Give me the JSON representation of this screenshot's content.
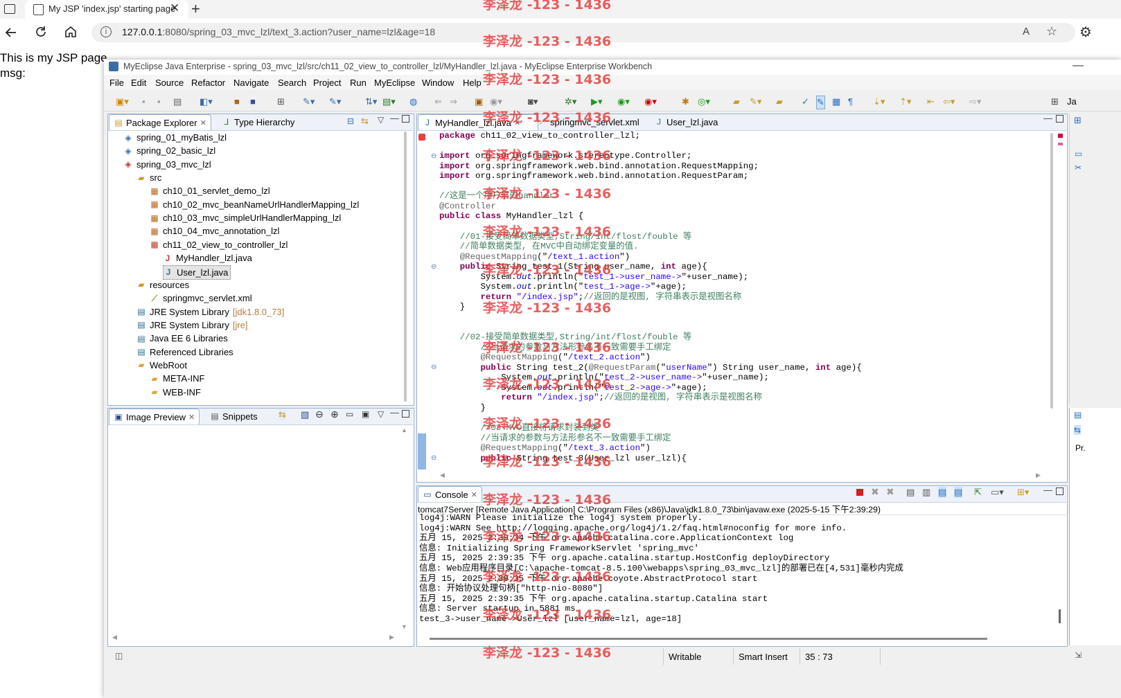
{
  "browser": {
    "tab_title": "My JSP 'index.jsp' starting page",
    "url_host": "127.0.0.1",
    "url_rest": ":8080/spring_03_mvc_lzl/text_3.action?user_name=lzl&age=18"
  },
  "page": {
    "line1": "This is my JSP page.",
    "line2": "msg:"
  },
  "watermark": "李泽龙 -123 - 1436",
  "eclipse": {
    "title": "MyEclipse Java Enterprise - spring_03_mvc_lzl/src/ch11_02_view_to_controller_lzl/MyHandler_lzl.java - MyEclipse Enterprise Workbench",
    "menu": [
      "File",
      "Edit",
      "Source",
      "Refactor",
      "Navigate",
      "Search",
      "Project",
      "Run",
      "MyEclipse",
      "Window",
      "Help"
    ],
    "perspective_label": "Ja"
  },
  "package_explorer": {
    "tabs": [
      "Package Explorer",
      "Type Hierarchy"
    ],
    "items": [
      {
        "label": "spring_01_myBatis_lzl",
        "icon": "project-icon",
        "depth": 0
      },
      {
        "label": "spring_02_basic_lzl",
        "icon": "project-icon",
        "depth": 0
      },
      {
        "label": "spring_03_mvc_lzl",
        "icon": "project-error-icon",
        "depth": 0
      },
      {
        "label": "src",
        "icon": "source-folder-icon",
        "depth": 1
      },
      {
        "label": "ch10_01_servlet_demo_lzl",
        "icon": "package-icon",
        "depth": 2
      },
      {
        "label": "ch10_02_mvc_beanNameUrlHandlerMapping_lzl",
        "icon": "package-icon",
        "depth": 2
      },
      {
        "label": "ch10_03_mvc_simpleUrlHandlerMapping_lzl",
        "icon": "package-icon",
        "depth": 2
      },
      {
        "label": "ch10_04_mvc_annotation_lzl",
        "icon": "package-icon",
        "depth": 2
      },
      {
        "label": "ch11_02_view_to_controller_lzl",
        "icon": "package-error-icon",
        "depth": 2
      },
      {
        "label": "MyHandler_lzl.java",
        "icon": "java-file-error-icon",
        "depth": 3
      },
      {
        "label": "User_lzl.java",
        "icon": "java-file-icon",
        "depth": 3
      },
      {
        "label": "resources",
        "icon": "source-folder-icon",
        "depth": 1
      },
      {
        "label": "springmvc_servlet.xml",
        "icon": "xml-file-icon",
        "depth": 2
      },
      {
        "label": "JRE System Library",
        "suffix": "[jdk1.8.0_73]",
        "icon": "library-icon",
        "depth": 1
      },
      {
        "label": "JRE System Library",
        "suffix": "[jre]",
        "icon": "library-icon",
        "depth": 1
      },
      {
        "label": "Java EE 6 Libraries",
        "icon": "library-icon",
        "depth": 1
      },
      {
        "label": "Referenced Libraries",
        "icon": "library-icon",
        "depth": 1
      },
      {
        "label": "WebRoot",
        "icon": "folder-icon",
        "depth": 1
      },
      {
        "label": "META-INF",
        "icon": "folder-icon",
        "depth": 2
      },
      {
        "label": "WEB-INF",
        "icon": "folder-icon",
        "depth": 2
      }
    ]
  },
  "preview": {
    "tabs": [
      "Image Preview",
      "Snippets"
    ]
  },
  "editor": {
    "tabs": [
      "MyHandler_lzl.java",
      "springmvc_servlet.xml",
      "User_lzl.java"
    ],
    "lines": [
      [
        [
          "kw",
          "package"
        ],
        [
          "",
          "ch11_02_view_to_controller_lzl;"
        ]
      ],
      [],
      [
        [
          "kw",
          "import"
        ],
        [
          "",
          "org.springframework.stereotype.Controller;"
        ]
      ],
      [
        [
          "kw",
          "import"
        ],
        [
          "",
          "org.springframework.web.bind.annotation.RequestMapping;"
        ]
      ],
      [
        [
          "kw",
          "import"
        ],
        [
          "",
          "org.springframework.web.bind.annotation.RequestParam;"
        ]
      ],
      [],
      [
        [
          "cm",
          "//这是一个用户层的handler"
        ]
      ],
      [
        [
          "ann",
          "@Controller"
        ]
      ],
      [
        [
          "kw",
          "public"
        ],
        [
          "kw",
          "class"
        ],
        [
          "",
          "MyHandler_lzl {"
        ]
      ],
      [],
      [
        [
          "cm",
          "    //01-接受简单数据类型,String/int/flost/fouble 等"
        ]
      ],
      [
        [
          "cm",
          "    //简单数据类型, 在MVC中自动绑定变量的值."
        ]
      ],
      [
        [
          "ann",
          "    @RequestMapping"
        ],
        [
          "",
          "(\""
        ],
        [
          "str",
          "/text_1.action"
        ],
        [
          "",
          "\")"
        ]
      ],
      [
        [
          "kw",
          "    public"
        ],
        [
          "",
          "String test_1(String user_name,"
        ],
        [
          "kw",
          "int"
        ],
        [
          "",
          "age){"
        ]
      ],
      [
        [
          "",
          "        System."
        ],
        [
          "it",
          "out"
        ],
        [
          "",
          ".println(\""
        ],
        [
          "str",
          "test_1->user_name->"
        ],
        [
          "",
          "\"+user_name);"
        ]
      ],
      [
        [
          "",
          "        System."
        ],
        [
          "it",
          "out"
        ],
        [
          "",
          ".println(\""
        ],
        [
          "str",
          "test_1->age->"
        ],
        [
          "",
          "\"+age);"
        ]
      ],
      [
        [
          "kw",
          "        return"
        ],
        [
          "str",
          "\"/index.jsp\""
        ],
        [
          "",
          ";"
        ],
        [
          "cm",
          "//返回的是视图, 字符串表示是视图名称"
        ]
      ],
      [
        [
          "",
          "    }"
        ]
      ],
      [],
      [],
      [
        [
          "cm",
          "    //02-接受简单数据类型,String/int/flost/fouble 等"
        ]
      ],
      [
        [
          "cm",
          "        //当请求的参数与方法形参名不一致需要手工绑定"
        ]
      ],
      [
        [
          "ann",
          "        @RequestMapping"
        ],
        [
          "",
          "(\""
        ],
        [
          "str",
          "/text_2.action"
        ],
        [
          "",
          "\")"
        ]
      ],
      [
        [
          "kw",
          "        public"
        ],
        [
          "",
          "String test_2("
        ],
        [
          "ann",
          "@RequestParam"
        ],
        [
          "",
          "(\""
        ],
        [
          "str",
          "userName"
        ],
        [
          "",
          "\") String user_name,"
        ],
        [
          "kw",
          "int"
        ],
        [
          "",
          "age){"
        ]
      ],
      [
        [
          "",
          "            System."
        ],
        [
          "it",
          "out"
        ],
        [
          "",
          ".println(\""
        ],
        [
          "str",
          "test_2->user_name->"
        ],
        [
          "",
          "\"+user_name);"
        ]
      ],
      [
        [
          "",
          "            System."
        ],
        [
          "it",
          "out"
        ],
        [
          "",
          ".println(\""
        ],
        [
          "str",
          "test_2->age->"
        ],
        [
          "",
          "\"+age);"
        ]
      ],
      [
        [
          "kw",
          "            return"
        ],
        [
          "str",
          "\"/index.jsp\""
        ],
        [
          "",
          ";"
        ],
        [
          "cm",
          "//返回的是视图, 字符串表示是视图名称"
        ]
      ],
      [
        [
          "",
          "        }"
        ]
      ],
      [],
      [
        [
          "cm",
          "        //03-MVC直接将请求封装到类"
        ]
      ],
      [
        [
          "cm",
          "        //当请求的参数与方法形参名不一致需要手工绑定"
        ]
      ],
      [
        [
          "ann",
          "        @RequestMapping"
        ],
        [
          "",
          "(\""
        ],
        [
          "str",
          "/text_3.action"
        ],
        [
          "",
          "\")"
        ]
      ],
      [
        [
          "kw",
          "        public"
        ],
        [
          "",
          "String test_3(User_lzl user_lzl){"
        ]
      ]
    ]
  },
  "console": {
    "tab": "Console",
    "header": "tomcat7Server [Remote Java Application] C:\\Program Files (x86)\\Java\\jdk1.8.0_73\\bin\\javaw.exe (2025-5-15 下午2:39:29)",
    "lines": [
      "log4j:WARN Please initialize the log4j system properly.",
      "log4j:WARN See http://logging.apache.org/log4j/1.2/faq.html#noconfig for more info.",
      "五月 15, 2025 2:39:34 下午 org.apache.catalina.core.ApplicationContext log",
      "信息: Initializing Spring FrameworkServlet 'spring_mvc'",
      "五月 15, 2025 2:39:35 下午 org.apache.catalina.startup.HostConfig deployDirectory",
      "信息: Web应用程序目录[C:\\apache-tomcat-8.5.100\\webapps\\spring_03_mvc_lzl]的部署已在[4,531]毫秒内完成",
      "五月 15, 2025 2:39:35 下午 org.apache.coyote.AbstractProtocol start",
      "信息: 开始协议处理句柄[\"http-nio-8080\"]",
      "五月 15, 2025 2:39:35 下午 org.apache.catalina.startup.Catalina start",
      "信息: Server startup in 5881 ms",
      "test_3->user_name->User_lzl [user_name=lzl, age=18]"
    ]
  },
  "statusbar": {
    "writable": "Writable",
    "insert_mode": "Smart Insert",
    "position": "35 : 73"
  },
  "right_rail": {
    "label": "Pr."
  }
}
